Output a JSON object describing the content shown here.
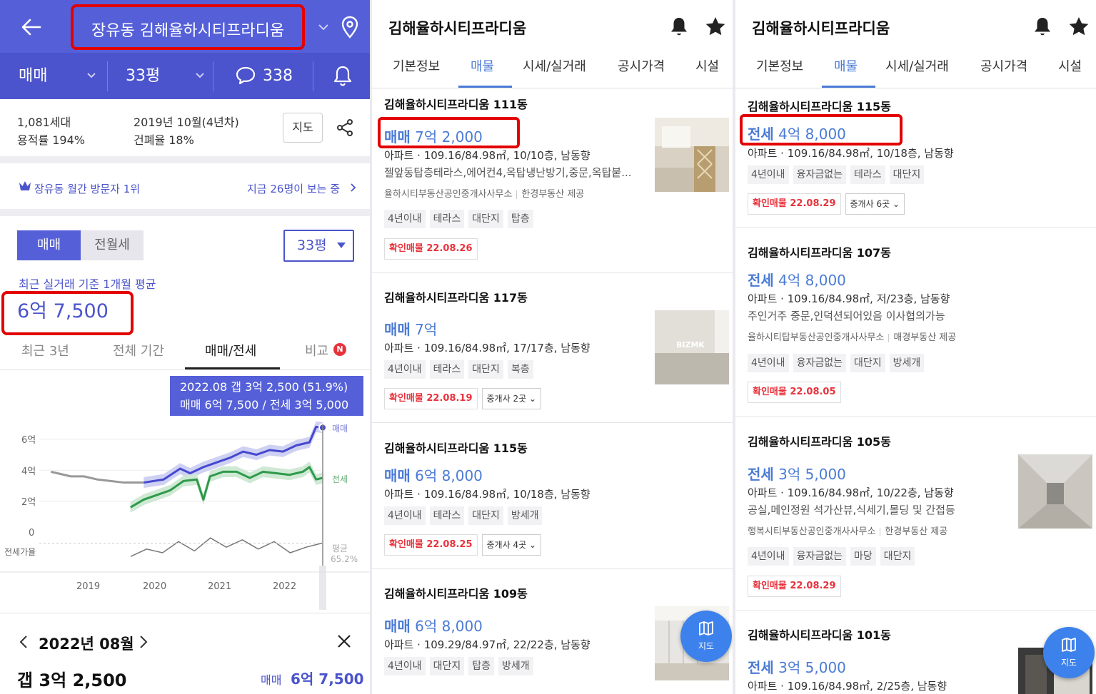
{
  "panel1": {
    "header": {
      "title": "장유동 김해율하시티프라디움",
      "deal_type": "매매",
      "size": "33평",
      "comment_count": "338"
    },
    "info": {
      "households": "1,081세대",
      "floor_ratio": "용적률 194%",
      "built": "2019년 10월(4년차)",
      "coverage": "건폐율 18%",
      "map_button": "지도"
    },
    "visitors": {
      "rank": "장유동 월간 방문자 1위",
      "now_viewing": "지금 26명이 보는 중"
    },
    "segment": {
      "sale": "매매",
      "rent": "전월세"
    },
    "size_select": "33평",
    "average": {
      "label": "최근 실거래 기준 1개월 평균",
      "value": "6억 7,500"
    },
    "chart_tabs": [
      "최근 3년",
      "전체 기간",
      "매매/전세",
      "비교"
    ],
    "badge_new": "N",
    "tooltip": {
      "line1": "2022.08  갭 3억 2,500 (51.9%)",
      "line2": "매매 6억 7,500 / 전세 3억 5,000"
    },
    "chart_labels": {
      "y_ticks": [
        "6억",
        "4억",
        "2억",
        "0"
      ],
      "ratio_label": "전세가율",
      "x_ticks": [
        "2019",
        "2020",
        "2021",
        "2022"
      ],
      "series_sale": "매매",
      "series_jeonse": "전세",
      "avg_label": "평균",
      "avg_value": "65.2%"
    },
    "detail": {
      "month": "2022년 08월",
      "gap": "갭 3억 2,500",
      "sale_label": "매매",
      "sale_value": "6억 7,500"
    }
  },
  "chart_data": {
    "type": "line",
    "x": [
      "2019",
      "2020",
      "2021",
      "2022"
    ],
    "ylim": [
      0,
      7
    ],
    "series": [
      {
        "name": "매매",
        "color": "#4548cf",
        "points": [
          [
            2019.9,
            3.2
          ],
          [
            2020.2,
            3.4
          ],
          [
            2020.45,
            4.1
          ],
          [
            2020.6,
            3.8
          ],
          [
            2020.8,
            4.2
          ],
          [
            2021.0,
            4.5
          ],
          [
            2021.2,
            4.8
          ],
          [
            2021.4,
            5.2
          ],
          [
            2021.6,
            5.0
          ],
          [
            2021.8,
            5.3
          ],
          [
            2022.0,
            5.2
          ],
          [
            2022.2,
            5.6
          ],
          [
            2022.4,
            5.8
          ],
          [
            2022.5,
            6.8
          ],
          [
            2022.6,
            6.75
          ]
        ]
      },
      {
        "name": "전세",
        "color": "#2e9a4a",
        "points": [
          [
            2019.7,
            1.6
          ],
          [
            2019.9,
            2.1
          ],
          [
            2020.1,
            2.4
          ],
          [
            2020.3,
            2.7
          ],
          [
            2020.5,
            3.3
          ],
          [
            2020.7,
            3.4
          ],
          [
            2020.8,
            2.1
          ],
          [
            2020.9,
            3.6
          ],
          [
            2021.1,
            3.9
          ],
          [
            2021.3,
            3.9
          ],
          [
            2021.5,
            3.5
          ],
          [
            2021.7,
            3.9
          ],
          [
            2021.9,
            3.8
          ],
          [
            2022.1,
            3.7
          ],
          [
            2022.3,
            3.9
          ],
          [
            2022.4,
            4.2
          ],
          [
            2022.5,
            3.4
          ],
          [
            2022.6,
            3.5
          ]
        ]
      },
      {
        "name": "",
        "color": "#999999",
        "points": [
          [
            2018.5,
            3.9
          ],
          [
            2018.8,
            3.6
          ],
          [
            2019.0,
            3.6
          ],
          [
            2019.2,
            3.4
          ],
          [
            2019.4,
            3.3
          ],
          [
            2019.6,
            3.2
          ],
          [
            2019.8,
            3.2
          ],
          [
            2019.9,
            3.2
          ]
        ]
      }
    ],
    "ratio_line": [
      58,
      62,
      60,
      66,
      61,
      68,
      63,
      67,
      62,
      66,
      60,
      63,
      65.2
    ]
  },
  "panel2": {
    "title": "김해율하시티프라디움",
    "tabs": [
      "기본정보",
      "매물",
      "시세/실거래",
      "공시가격",
      "시설"
    ],
    "listings": [
      {
        "name": "김해율하시티프라디움 111동",
        "kind": "매매",
        "price": "7억 2,000",
        "spec": "아파트 · 109.16/84.98㎡, 10/10층, 남동향",
        "desc": "젤앞동탑층테라스,에어컨4,옥탑냉난방기,중문,옥탑붙...",
        "agent": "율하시티부동산공인중개사사무소",
        "source": "한경부동산 제공",
        "tags": [
          "4년이내",
          "테라스",
          "대단지",
          "탑층"
        ],
        "confirmed": "확인매물 22.08.26",
        "broker": ""
      },
      {
        "name": "김해율하시티프라디움 117동",
        "kind": "매매",
        "price": "7억",
        "spec": "아파트 · 109.16/84.98㎡, 17/17층, 남동향",
        "tags": [
          "4년이내",
          "테라스",
          "대단지",
          "복층"
        ],
        "confirmed": "확인매물 22.08.19",
        "broker": "중개사 2곳",
        "thumb_text": "BIZMK"
      },
      {
        "name": "김해율하시티프라디움 115동",
        "kind": "매매",
        "price": "6억 8,000",
        "spec": "아파트 · 109.16/84.98㎡, 10/18층, 남동향",
        "tags": [
          "4년이내",
          "테라스",
          "대단지",
          "방세개"
        ],
        "confirmed": "확인매물 22.08.25",
        "broker": "중개사 4곳"
      },
      {
        "name": "김해율하시티프라디움 109동",
        "kind": "매매",
        "price": "6억 8,000",
        "spec": "아파트 · 109.29/84.97㎡, 22/22층, 남동향",
        "tags": [
          "4년이내",
          "대단지",
          "탑층",
          "방세개"
        ]
      }
    ],
    "map_fab": "지도"
  },
  "panel3": {
    "title": "김해율하시티프라디움",
    "tabs": [
      "기본정보",
      "매물",
      "시세/실거래",
      "공시가격",
      "시설"
    ],
    "listings": [
      {
        "name": "김해율하시티프라디움 115동",
        "kind": "전세",
        "price": "4억 8,000",
        "spec": "아파트 · 109.16/84.98㎡, 10/18층, 남동향",
        "tags": [
          "4년이내",
          "융자금없는",
          "테라스",
          "대단지"
        ],
        "confirmed": "확인매물 22.08.29",
        "broker": "중개사 6곳"
      },
      {
        "name": "김해율하시티프라디움 107동",
        "kind": "전세",
        "price": "4억 8,000",
        "spec": "아파트 · 109.16/84.98㎡, 저/23층, 남동향",
        "desc": "주인거주 중문,인덕션되어있음 이사협의가능",
        "agent": "율하시티탑부동산공인중개사사무소",
        "source": "매경부동산 제공",
        "tags": [
          "4년이내",
          "융자금없는",
          "대단지",
          "방세개"
        ],
        "confirmed": "확인매물 22.08.05"
      },
      {
        "name": "김해율하시티프라디움 105동",
        "kind": "전세",
        "price": "3억 5,000",
        "spec": "아파트 · 109.16/84.98㎡, 10/22층, 남동향",
        "desc": "공실,메인정원 석가산뷰,식세기,몰딩 및 간접등",
        "agent": "행복시티부동산공인중개사사무소",
        "source": "한경부동산 제공",
        "tags": [
          "4년이내",
          "융자금없는",
          "마당",
          "대단지"
        ],
        "confirmed": "확인매물 22.08.29"
      },
      {
        "name": "김해율하시티프라디움 101동",
        "kind": "전세",
        "price": "3억 5,000",
        "spec": "아파트 · 109.16/84.98㎡, 2/25층, 남동향"
      }
    ],
    "map_fab": "지도"
  }
}
